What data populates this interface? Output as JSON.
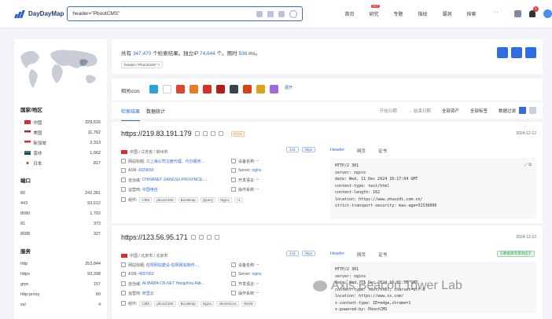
{
  "header": {
    "logo_text": "DayDayMap",
    "search_value": "header=\"PbootCMS\"",
    "nav": [
      "首页",
      "研究",
      "专题",
      "指纹",
      "漏洞",
      "探索",
      "···"
    ],
    "hot_badge": "HOT",
    "notification_count": "9"
  },
  "summary": {
    "prefix": "共有",
    "total": "347,470",
    "mid1": "个检索结果。独立IP",
    "ips": "74,644",
    "mid2": "个。用时",
    "time": "536",
    "suffix": "ms。",
    "query_tag": "header=\"PbootCMS\" ×"
  },
  "related": {
    "label": "相关icon:",
    "expand": "展开"
  },
  "tabs": {
    "results": "检索结果",
    "stats": "数据统计"
  },
  "filters": [
    "开始日期",
    "→ 结束日期",
    "全部资产",
    "全部标签",
    "数据过滤"
  ],
  "left": {
    "country_title": "国家/地区",
    "countries": [
      {
        "name": "中国",
        "count": "329,516",
        "color": "#e02b2b"
      },
      {
        "name": "美国",
        "count": "11,762",
        "color": "#3b5ba9"
      },
      {
        "name": "新加坡",
        "count": "2,313",
        "color": "#e02b2b"
      },
      {
        "name": "南非",
        "count": "1,662",
        "color": "#2f8f4a"
      },
      {
        "name": "日本",
        "count": "817",
        "color": "#e8e8e8"
      }
    ],
    "port_title": "端口",
    "ports": [
      {
        "name": "80",
        "count": "242,381"
      },
      {
        "name": "443",
        "count": "93,512"
      },
      {
        "name": "8080",
        "count": "1,702"
      },
      {
        "name": "81",
        "count": "373"
      },
      {
        "name": "8088",
        "count": "327"
      }
    ],
    "service_title": "服务",
    "services": [
      {
        "name": "http",
        "count": "253,844"
      },
      {
        "name": "https",
        "count": "93,398"
      },
      {
        "name": "grpc",
        "count": "157"
      },
      {
        "name": "http-proxy",
        "count": "60"
      },
      {
        "name": "ssl",
        "count": "4"
      }
    ]
  },
  "cards": [
    {
      "url": "https://219.83.191.179",
      "badge": "ICON",
      "date": "2024-12-12",
      "location": "中国 / 江苏省 / 常州市",
      "title_label": "网站标题:",
      "title_value": "江上海公司注册代理、代办服务...",
      "device_label": "设备名称:",
      "device_value": "--",
      "asn_label": "ASN:",
      "asn_value": "4323650",
      "server_label": "Server:",
      "server_value": "nginx",
      "as_label": "自治域:",
      "as_value": "CHINANET-JIANGSU-PROVINCE-...",
      "dev_lang_label": "开发语言:",
      "dev_lang_value": "--",
      "isp_label": "运营商:",
      "isp_value": "中国电信",
      "os_label": "操作系统:",
      "os_value": "--",
      "comp_label": "组件:",
      "components": [
        "CMS",
        "pbootCMS",
        "Bootstrap",
        "jQuery",
        "Nginx",
        "+1"
      ],
      "versions": [
        "443",
        "https"
      ],
      "rtabs": [
        "Header",
        "网页",
        "证书"
      ],
      "raw": "HTTP/2 301\nserver: nginx\ndate: Wed, 11 Dec 2024 16:17:04 GMT\ncontent-type: text/html\ncontent-length: 162\nlocation: https://www.zhuozdi.com.cn/\nstrict-transport-security: max-age=31536000"
    },
    {
      "url": "https://123.56.95.171",
      "badge": "",
      "date": "2024-12-12",
      "location": "中国 / 北京市 / 北京市",
      "title_label": "网站标题:",
      "title_value": "信阳网站建设-信阳网站制作-...",
      "device_label": "设备名称:",
      "device_value": "--",
      "asn_label": "ASN:",
      "asn_value": "4837963",
      "server_label": "Server:",
      "server_value": "nginx",
      "as_label": "自治域:",
      "as_value": "ALIBABA-CN-NET Hangzhou Alib...",
      "dev_lang_label": "开发语言:",
      "dev_lang_value": "--",
      "isp_label": "运营商:",
      "isp_value": "阿里云",
      "os_label": "操作系统:",
      "os_value": "--",
      "comp_label": "组件:",
      "components": [
        "CMS",
        "pbootCMS",
        "Bootstrap",
        "Nginx",
        "ekmeticcss",
        "WOW"
      ],
      "versions": [
        "443",
        "https"
      ],
      "green_tag": "与数据库等漏洞提示",
      "rtabs": [
        "Header",
        "网页",
        "证书"
      ],
      "raw": "HTTP/2 301\nserver: nginx\ndate: Wed, 11 Dec 2024 16:01:56 GMT\ncontent-type: text/html; charset=utf-8\nlocation: https://www.xx.com/\nx-content-type: IE=edge,chrome=1\nx-powered-by: PbootCMS"
    }
  ],
  "watermark": "Axis Beacon Tower Lab"
}
